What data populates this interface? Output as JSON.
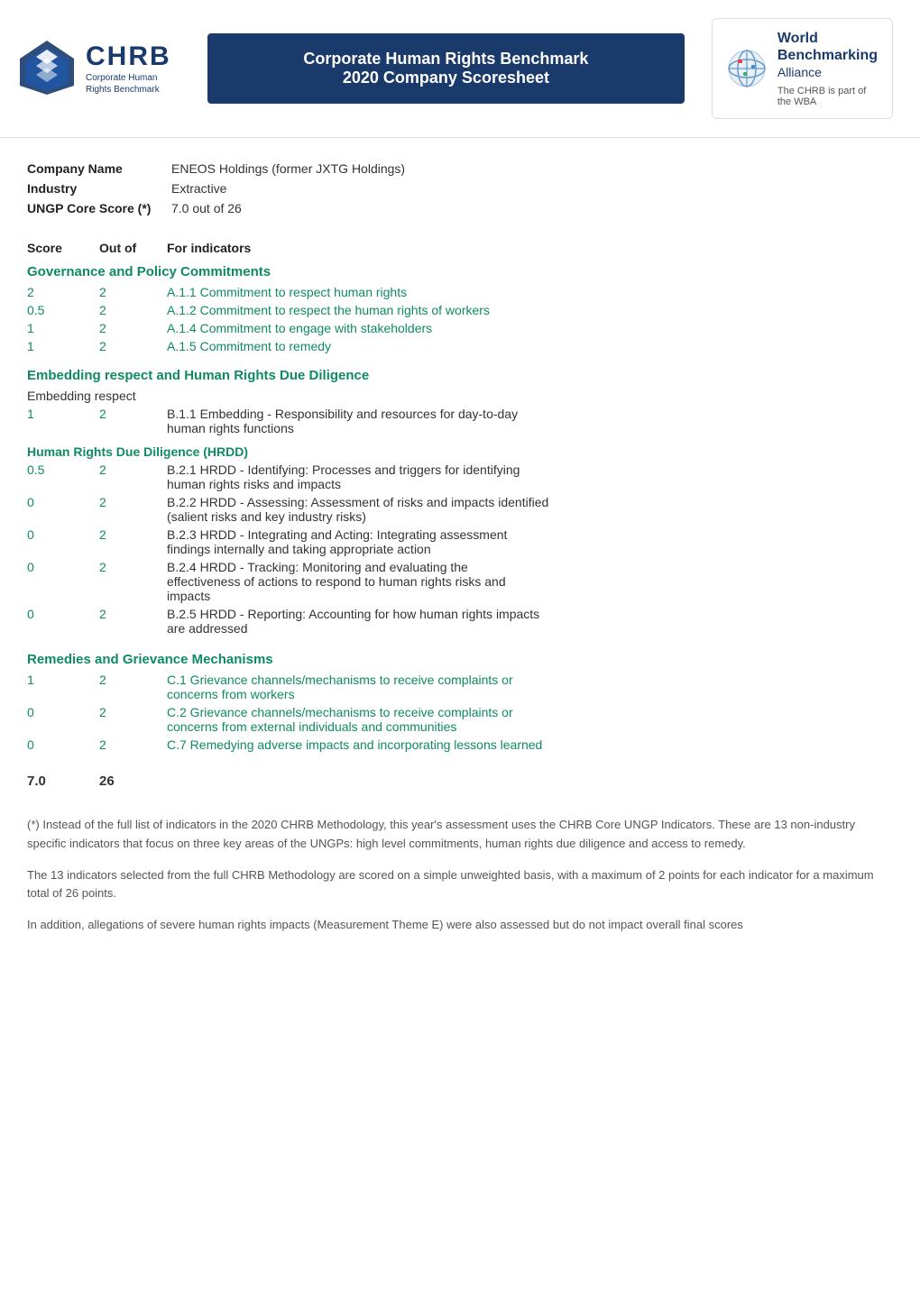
{
  "header": {
    "logo": {
      "chrb": "CHRB",
      "line1": "Corporate Human",
      "line2": "Rights Benchmark"
    },
    "title_line1": "Corporate Human Rights Benchmark",
    "title_line2": "2020 Company Scoresheet",
    "wba": {
      "name_line1": "World",
      "name_line2": "Benchmarking",
      "name_line3": "Alliance",
      "desc1": "The CHRB is part of",
      "desc2": "the WBA"
    }
  },
  "company": {
    "name_label": "Company Name",
    "name_value": "ENEOS Holdings  (former JXTG Holdings)",
    "industry_label": "Industry",
    "industry_value": "Extractive",
    "score_label": "UNGP Core Score (*)",
    "score_value": "7.0 out of 26"
  },
  "table": {
    "col_score": "Score",
    "col_out": "Out of",
    "col_indicators": "For indicators"
  },
  "sections": {
    "governance": {
      "title": "Governance and Policy Commitments",
      "rows": [
        {
          "score": "2",
          "out": "2",
          "indicator": "A.1.1 Commitment to respect human rights"
        },
        {
          "score": "0.5",
          "out": "2",
          "indicator": "A.1.2 Commitment to respect the human rights of workers"
        },
        {
          "score": "1",
          "out": "2",
          "indicator": "A.1.4 Commitment to engage with stakeholders"
        },
        {
          "score": "1",
          "out": "2",
          "indicator": "A.1.5 Commitment to remedy"
        }
      ]
    },
    "embedding": {
      "title": "Embedding respect and Human Rights Due Diligence",
      "sub1": {
        "label": "Embedding respect",
        "rows": [
          {
            "score": "1",
            "out": "2",
            "indicator": "B.1.1 Embedding - Responsibility and resources for day-to-day\nhuman rights functions"
          }
        ]
      },
      "sub2": {
        "label": "Human Rights Due Diligence (HRDD)",
        "rows": [
          {
            "score": "0.5",
            "out": "2",
            "indicator": "B.2.1 HRDD - Identifying: Processes and triggers for identifying\nhuman rights risks and impacts"
          },
          {
            "score": "0",
            "out": "2",
            "indicator": "B.2.2 HRDD - Assessing: Assessment of risks and impacts identified\n(salient risks and key industry risks)"
          },
          {
            "score": "0",
            "out": "2",
            "indicator": "B.2.3 HRDD - Integrating and Acting: Integrating assessment\nfindings internally and taking appropriate action"
          },
          {
            "score": "0",
            "out": "2",
            "indicator": "B.2.4 HRDD - Tracking: Monitoring and evaluating the\neffectiveness of actions to respond to human rights risks and\nimpacts"
          },
          {
            "score": "0",
            "out": "2",
            "indicator": "B.2.5 HRDD - Reporting: Accounting for how human rights impacts\nare addressed"
          }
        ]
      }
    },
    "remedies": {
      "title": "Remedies and Grievance Mechanisms",
      "rows": [
        {
          "score": "1",
          "out": "2",
          "indicator": "C.1 Grievance channels/mechanisms to receive complaints or\nconcerns from workers"
        },
        {
          "score": "0",
          "out": "2",
          "indicator": "C.2 Grievance channels/mechanisms to receive complaints or\nconcerns from external individuals and communities"
        },
        {
          "score": "0",
          "out": "2",
          "indicator": "C.7 Remedying adverse impacts and incorporating lessons learned"
        }
      ]
    }
  },
  "total": {
    "score": "7.0",
    "out": "26"
  },
  "footnotes": [
    "(*) Instead of the full list of indicators in the 2020 CHRB Methodology, this year's assessment uses the CHRB Core UNGP Indicators. These are 13 non-industry specific indicators that focus on three key areas of the UNGPs: high level commitments, human rights due diligence and access to remedy.",
    "The 13 indicators selected from the full CHRB Methodology are scored on a simple unweighted basis, with a maximum of 2 points for each indicator for a maximum total of 26 points.",
    "In addition, allegations of severe human rights impacts (Measurement Theme E) were also assessed but do not impact overall final scores"
  ]
}
